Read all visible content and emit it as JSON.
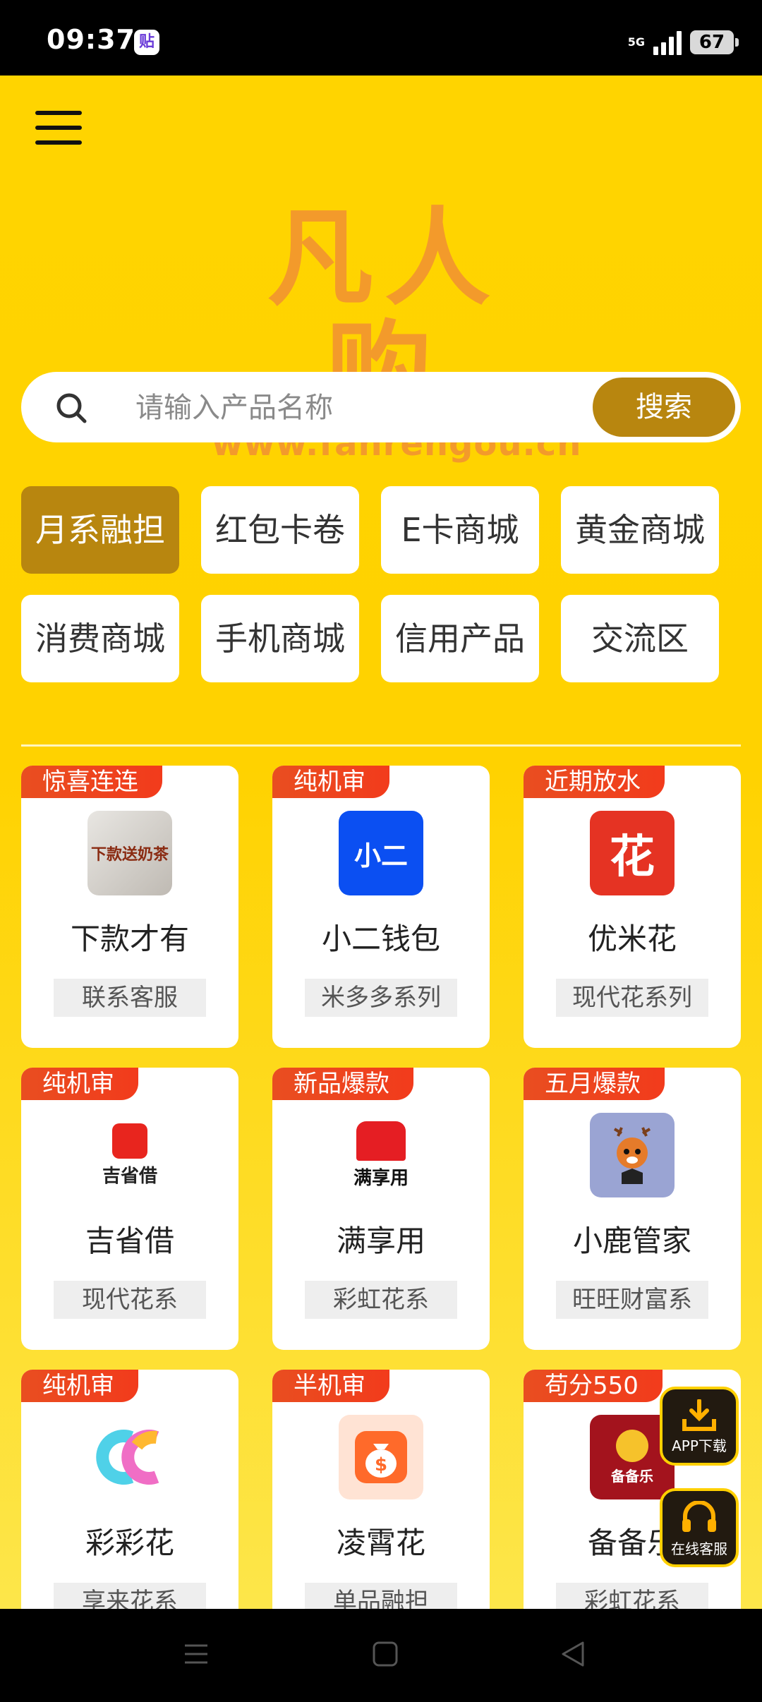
{
  "status": {
    "time": "09:37",
    "app_badge": "贴",
    "network": "5G",
    "battery": "67"
  },
  "logo": {
    "title": "凡人购",
    "url": "www.fanrengou.cn"
  },
  "search": {
    "placeholder": "请输入产品名称",
    "button": "搜索"
  },
  "categories": [
    "月系融担",
    "红包卡卷",
    "E卡商城",
    "黄金商城",
    "消费商城",
    "手机商城",
    "信用产品",
    "交流区"
  ],
  "active_category": "月系融担",
  "products": [
    {
      "badge": "惊喜连连",
      "name": "下款才有",
      "tag": "联系客服",
      "logo_text": "下款送奶茶"
    },
    {
      "badge": "纯机审",
      "name": "小二钱包",
      "tag": "米多多系列",
      "logo_text": "小二"
    },
    {
      "badge": "近期放水",
      "name": "优米花",
      "tag": "现代花系列",
      "logo_text": "花"
    },
    {
      "badge": "纯机审",
      "name": "吉省借",
      "tag": "现代花系",
      "logo_text": "吉省借"
    },
    {
      "badge": "新品爆款",
      "name": "满享用",
      "tag": "彩虹花系",
      "logo_text": "满享用"
    },
    {
      "badge": "五月爆款",
      "name": "小鹿管家",
      "tag": "旺旺财富系",
      "logo_text": ""
    },
    {
      "badge": "纯机审",
      "name": "彩彩花",
      "tag": "享来花系",
      "logo_text": ""
    },
    {
      "badge": "半机审",
      "name": "凌霄花",
      "tag": "单品融担",
      "logo_text": ""
    },
    {
      "badge": "苟分550",
      "name": "备备乐",
      "tag": "彩虹花系",
      "logo_text": "备备乐"
    }
  ],
  "floating": {
    "download": "APP下载",
    "service": "在线客服"
  },
  "colors": {
    "primary": "#ffd000",
    "accent": "#b8860f",
    "badge": "#e94e20",
    "logo": "#f39a2b"
  }
}
